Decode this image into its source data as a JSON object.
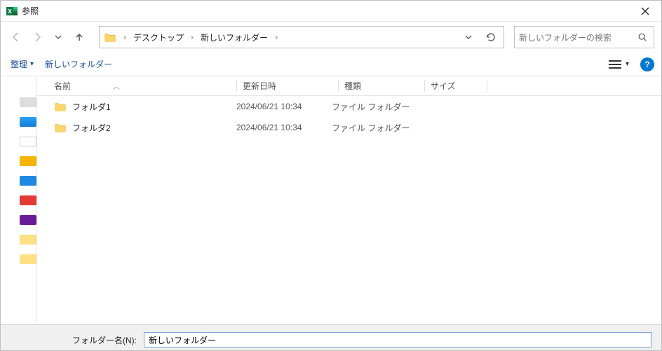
{
  "titlebar": {
    "title": "参照"
  },
  "nav": {
    "breadcrumbs": [
      "デスクトップ",
      "新しいフォルダー"
    ]
  },
  "search": {
    "placeholder": "新しいフォルダーの検索"
  },
  "toolbar": {
    "organize": "整理",
    "new_folder": "新しいフォルダー"
  },
  "columns": {
    "name": "名前",
    "date": "更新日時",
    "type": "種類",
    "size": "サイズ"
  },
  "rows": [
    {
      "name": "フォルダ1",
      "date": "2024/06/21 10:34",
      "type": "ファイル フォルダー",
      "size": ""
    },
    {
      "name": "フォルダ2",
      "date": "2024/06/21 10:34",
      "type": "ファイル フォルダー",
      "size": ""
    }
  ],
  "footer": {
    "folder_label": "フォルダー名(N):",
    "folder_value": "新しいフォルダー"
  }
}
